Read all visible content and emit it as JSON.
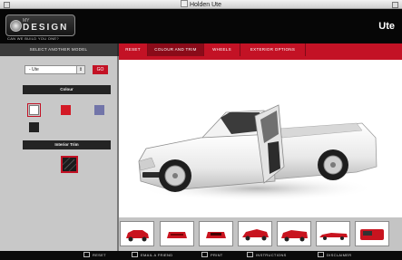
{
  "window": {
    "title": "Holden Ute"
  },
  "header": {
    "logo_small": "MY",
    "logo_main": "DESIGN",
    "tagline": "CAN WE BUILD YOU ONE?",
    "model_name": "Ute"
  },
  "nav": {
    "select_another": "SELECT ANOTHER MODEL",
    "tabs": [
      {
        "label": "RESET",
        "active": false
      },
      {
        "label": "COLOUR AND TRIM",
        "active": true
      },
      {
        "label": "WHEELS",
        "active": false
      },
      {
        "label": "EXTERIOR OPTIONS",
        "active": false
      }
    ]
  },
  "sidebar": {
    "model_select_value": "- Ute",
    "go_label": "GO",
    "colour_heading": "Colour",
    "colours": [
      {
        "name": "white",
        "hex": "#ffffff",
        "selected": true
      },
      {
        "name": "red",
        "hex": "#d31a26",
        "selected": false
      },
      {
        "name": "blue",
        "hex": "#7275a9",
        "selected": false
      },
      {
        "name": "black",
        "hex": "#222222",
        "selected": false
      }
    ],
    "interior_heading": "Interior Trim"
  },
  "footer": {
    "items": [
      {
        "label": "RESET",
        "icon": "reset-icon"
      },
      {
        "label": "EMAIL A FRIEND",
        "icon": "email-icon"
      },
      {
        "label": "PRINT",
        "icon": "print-icon"
      },
      {
        "label": "INSTRUCTIONS",
        "icon": "instructions-icon"
      },
      {
        "label": "DISCLAIMER",
        "icon": "disclaimer-icon"
      }
    ]
  }
}
